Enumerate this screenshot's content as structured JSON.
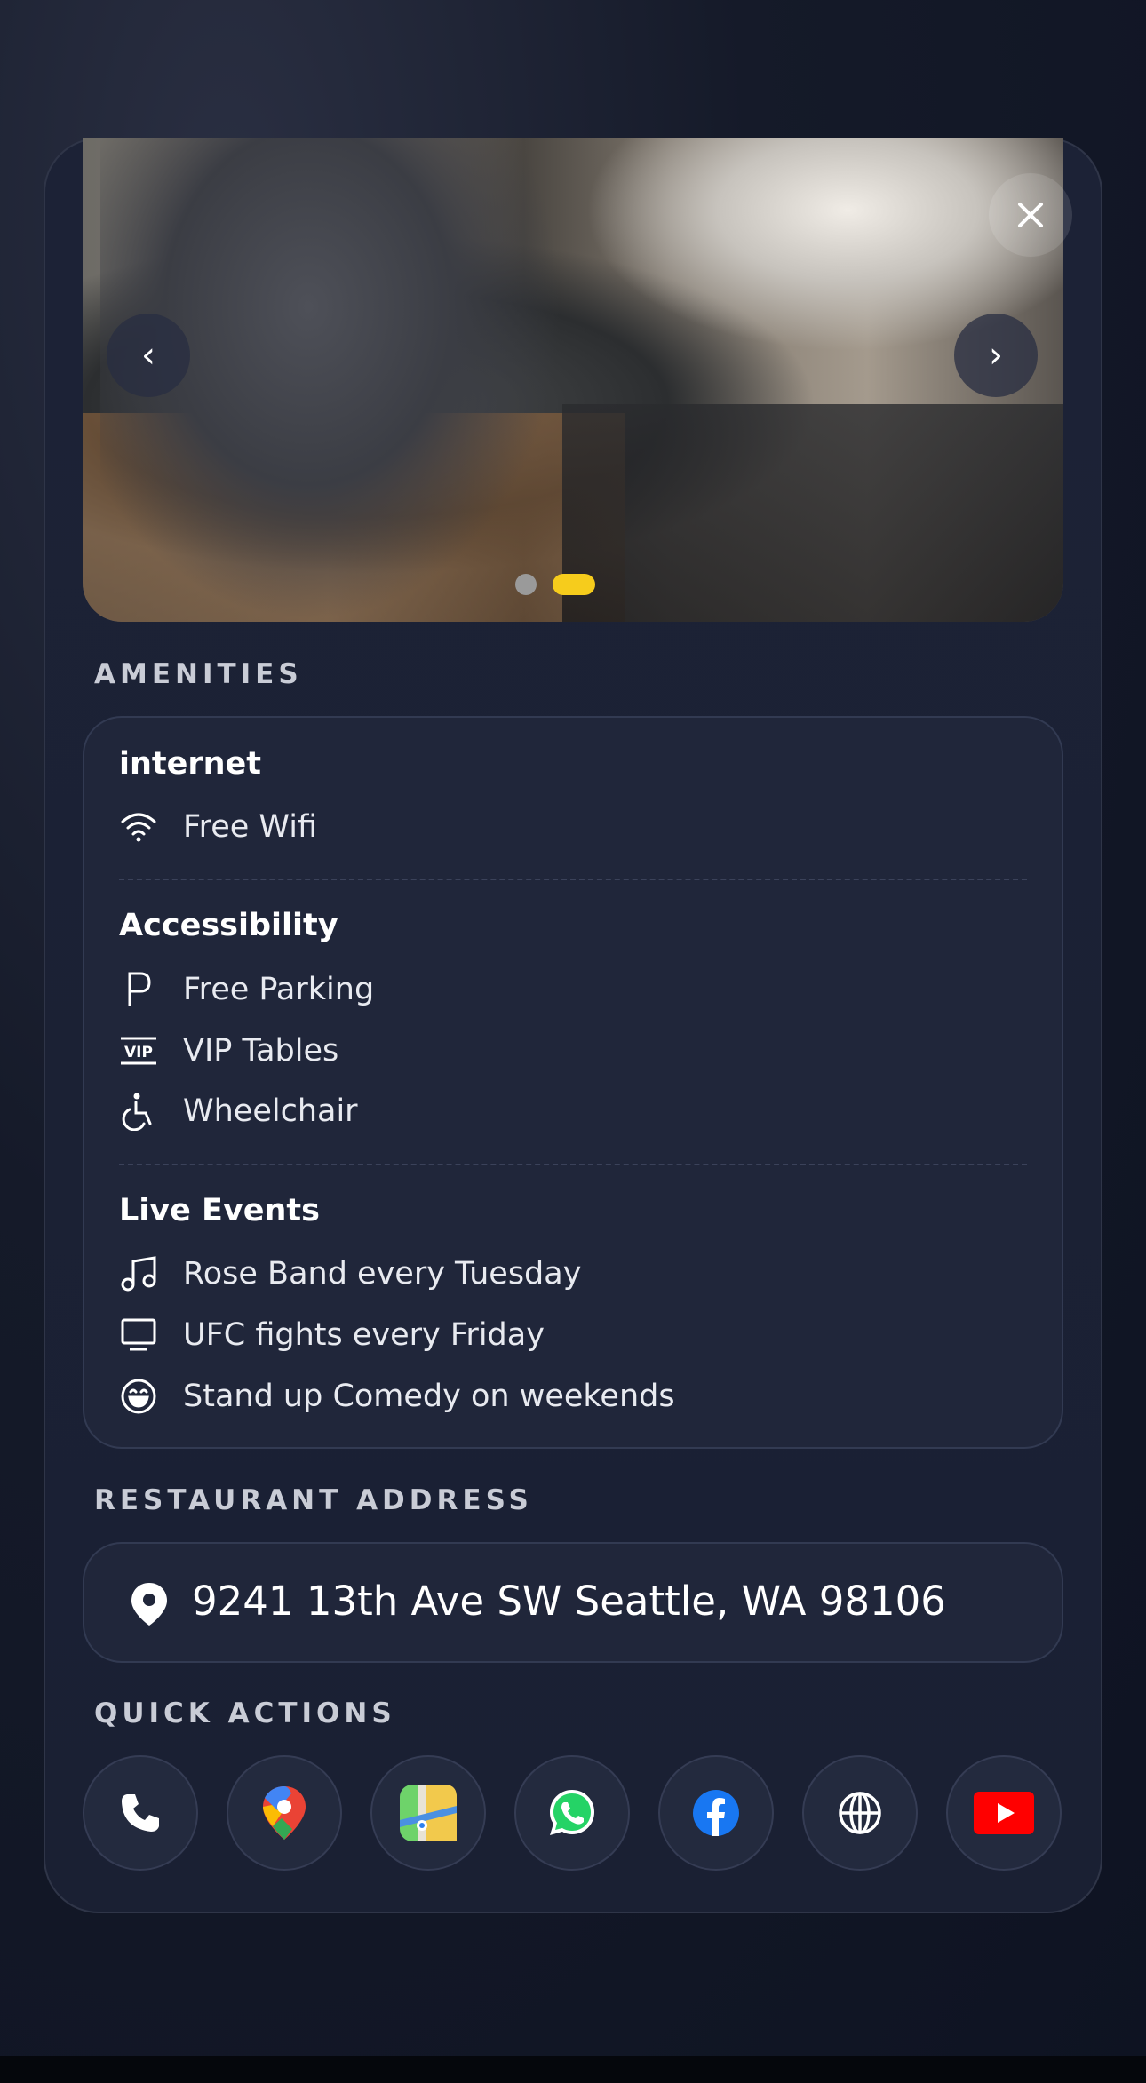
{
  "carousel": {
    "prev_glyph": "‹",
    "next_glyph": "›",
    "close_icon": "close-icon",
    "slide_count": 2,
    "active_slide": 2,
    "active_color": "#f6cc1c"
  },
  "amenities": {
    "label": "AMENITIES",
    "groups": [
      {
        "title": "internet",
        "items": [
          {
            "icon": "wifi-icon",
            "text": "Free Wifi"
          }
        ]
      },
      {
        "title": "Accessibility",
        "items": [
          {
            "icon": "parking-icon",
            "text": "Free Parking"
          },
          {
            "icon": "vip-icon",
            "text": "VIP Tables"
          },
          {
            "icon": "wheelchair-icon",
            "text": "Wheelchair"
          }
        ]
      },
      {
        "title": "Live Events",
        "items": [
          {
            "icon": "music-note-icon",
            "text": "Rose Band every Tuesday"
          },
          {
            "icon": "tv-icon",
            "text": "UFC fights every Friday"
          },
          {
            "icon": "laugh-face-icon",
            "text": "Stand up Comedy on weekends"
          }
        ]
      }
    ]
  },
  "address": {
    "label": "RESTAURANT ADDRESS",
    "text": "9241 13th Ave SW Seattle, WA 98106",
    "icon": "location-pin-icon"
  },
  "quick_actions": {
    "label": "QUICK ACTIONS",
    "items": [
      {
        "name": "phone",
        "icon": "phone-icon"
      },
      {
        "name": "google-maps",
        "icon": "google-maps-icon"
      },
      {
        "name": "apple-maps",
        "icon": "apple-maps-icon"
      },
      {
        "name": "whatsapp",
        "icon": "whatsapp-icon"
      },
      {
        "name": "facebook",
        "icon": "facebook-icon"
      },
      {
        "name": "website",
        "icon": "globe-icon"
      },
      {
        "name": "youtube",
        "icon": "youtube-icon"
      }
    ]
  }
}
